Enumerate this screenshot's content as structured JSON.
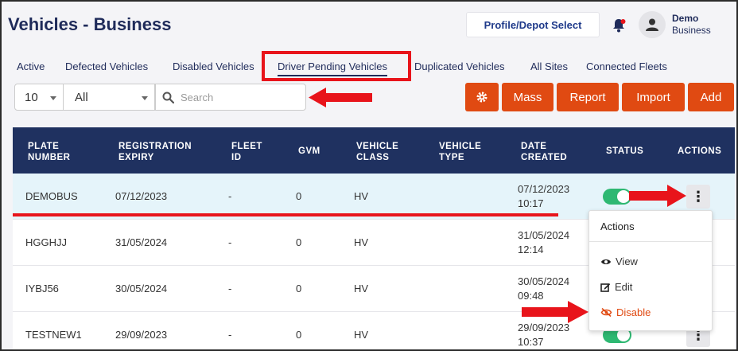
{
  "header": {
    "title": "Vehicles - Business",
    "profile_button": "Profile/Depot Select",
    "user_name": "Demo",
    "user_role": "Business"
  },
  "tabs": [
    {
      "label": "Active"
    },
    {
      "label": "Defected Vehicles"
    },
    {
      "label": "Disabled Vehicles"
    },
    {
      "label": "Driver Pending Vehicles"
    },
    {
      "label": "Duplicated Vehicles"
    },
    {
      "label": "All Sites"
    },
    {
      "label": "Connected Fleets"
    }
  ],
  "controls": {
    "page_size": "10",
    "filter": "All",
    "search_placeholder": "Search",
    "buttons": {
      "mass": "Mass",
      "report": "Report",
      "import": "Import",
      "add": "Add"
    }
  },
  "table": {
    "headers": {
      "plate_l1": "PLATE",
      "plate_l2": "NUMBER",
      "reg_l1": "REGISTRATION",
      "reg_l2": "EXPIRY",
      "fleet_l1": "FLEET",
      "fleet_l2": "ID",
      "gvm": "GVM",
      "vclass_l1": "VEHICLE",
      "vclass_l2": "CLASS",
      "vtype_l1": "VEHICLE",
      "vtype_l2": "TYPE",
      "date_l1": "DATE",
      "date_l2": "CREATED",
      "status": "STATUS",
      "actions": "ACTIONS"
    },
    "rows": [
      {
        "plate": "DEMOBUS",
        "expiry": "07/12/2023",
        "fleet_id": "-",
        "gvm": "0",
        "vclass": "HV",
        "date": "07/12/2023",
        "time": "10:17"
      },
      {
        "plate": "HGGHJJ",
        "expiry": "31/05/2024",
        "fleet_id": "-",
        "gvm": "0",
        "vclass": "HV",
        "date": "31/05/2024",
        "time": "12:14"
      },
      {
        "plate": "IYBJ56",
        "expiry": "30/05/2024",
        "fleet_id": "-",
        "gvm": "0",
        "vclass": "HV",
        "date": "30/05/2024",
        "time": "09:48"
      },
      {
        "plate": "TESTNEW1",
        "expiry": "29/09/2023",
        "fleet_id": "-",
        "gvm": "0",
        "vclass": "HV",
        "date": "29/09/2023",
        "time": "10:37"
      }
    ]
  },
  "actions_menu": {
    "title": "Actions",
    "view": "View",
    "edit": "Edit",
    "disable": "Disable"
  },
  "colors": {
    "navy": "#1f3160",
    "orange": "#e04a12",
    "annotation_red": "#e8141b",
    "toggle_green": "#2eb872"
  }
}
